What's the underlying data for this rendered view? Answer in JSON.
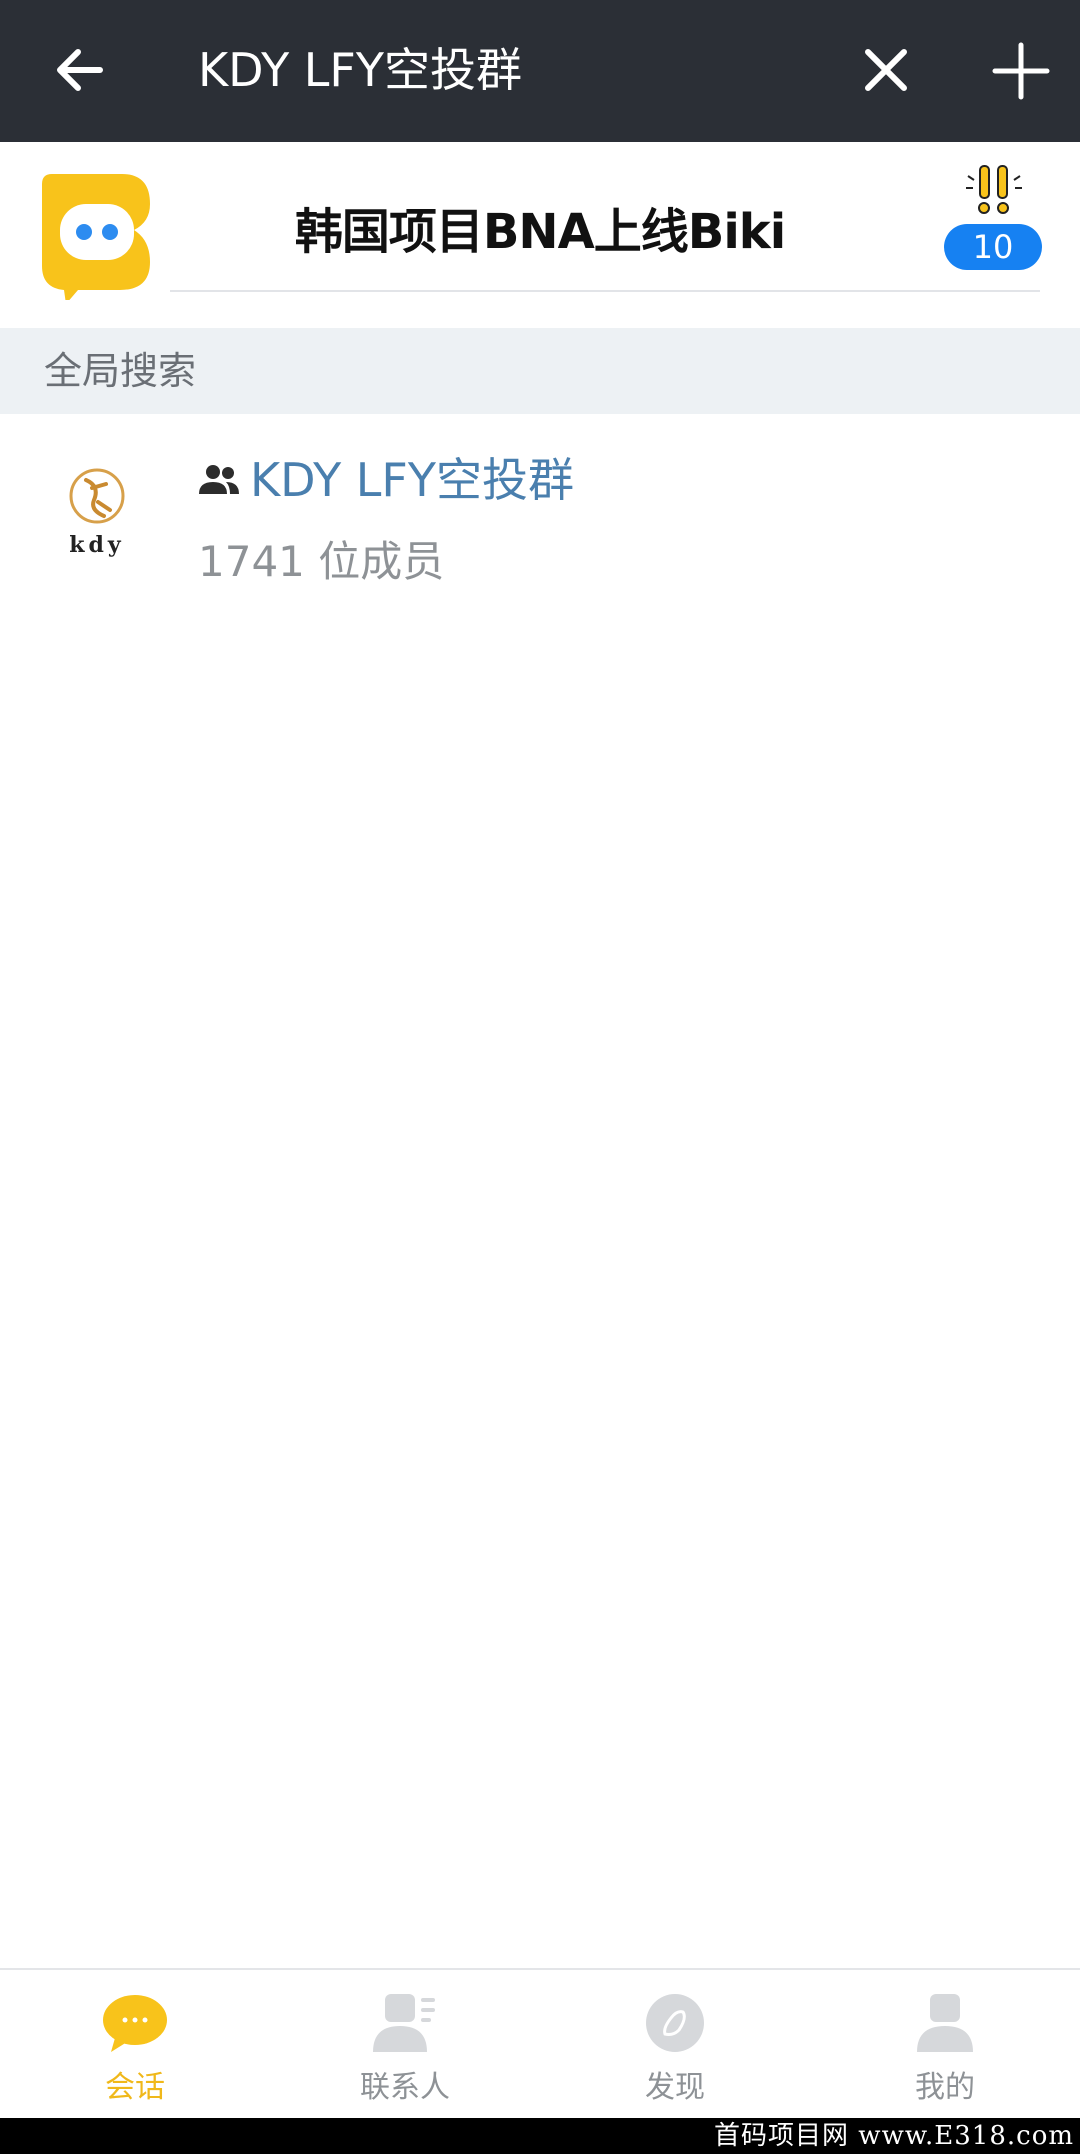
{
  "colors": {
    "top_bar_bg": "#2b2f36",
    "accent_yellow": "#f0b81a",
    "badge_blue": "#1681f2",
    "link_blue": "#4a7fae",
    "section_bg": "#edf1f4"
  },
  "top_bar": {
    "back_icon": "arrow-left-icon",
    "search_query": "KDY LFY空投群",
    "clear_icon": "close-icon",
    "add_icon": "plus-icon"
  },
  "pinned_chat": {
    "title": "韩国项目BNA上线Biki",
    "unread_count": "10",
    "logo_icon": "biki-logo-icon",
    "alert_icon": "alert-exclamation-icon"
  },
  "section": {
    "label": "全局搜索"
  },
  "results": [
    {
      "name": "KDY LFY空投群",
      "members": "1741 位成员",
      "type_icon": "group-people-icon",
      "avatar_text": "kdy"
    }
  ],
  "bottom_nav": {
    "items": [
      {
        "label": "会话",
        "icon": "chat-bubble-icon",
        "active": true
      },
      {
        "label": "联系人",
        "icon": "contacts-icon",
        "active": false
      },
      {
        "label": "发现",
        "icon": "compass-icon",
        "active": false
      },
      {
        "label": "我的",
        "icon": "profile-icon",
        "active": false
      }
    ]
  },
  "watermark": {
    "text": "首码项目网 www.E318.com"
  }
}
